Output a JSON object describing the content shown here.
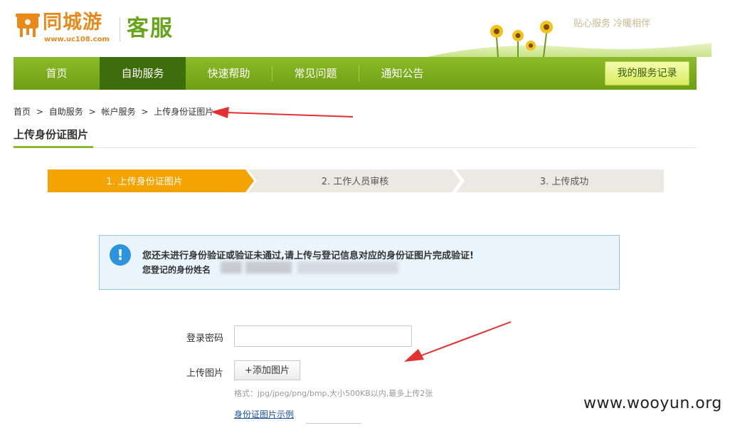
{
  "header": {
    "logo_text": "同城游",
    "logo_url": "www.uc108.com",
    "service_title": "客服",
    "slogan": "贴心服务 冷暖相伴"
  },
  "nav": {
    "items": [
      {
        "label": "首页",
        "active": false
      },
      {
        "label": "自助服务",
        "active": true
      },
      {
        "label": "快速帮助",
        "active": false
      },
      {
        "label": "常见问题",
        "active": false
      },
      {
        "label": "通知公告",
        "active": false
      }
    ],
    "records_button": "我的服务记录"
  },
  "breadcrumb": {
    "items": [
      "首页",
      "自助服务",
      "帐户服务",
      "上传身份证图片"
    ],
    "separator": ">"
  },
  "page_title": "上传身份证图片",
  "steps": [
    {
      "label": "1. 上传身份证图片",
      "active": true
    },
    {
      "label": "2. 工作人员审核",
      "active": false
    },
    {
      "label": "3. 上传成功",
      "active": false
    }
  ],
  "notice": {
    "icon": "exclamation-icon",
    "message": "您还未进行身份验证或验证未通过,请上传与登记信息对应的身份证图片完成验证!",
    "registered_label": "您登记的身份姓名"
  },
  "form": {
    "password_label": "登录密码",
    "password_value": "",
    "upload_label": "上传图片",
    "add_image_button": "+添加图片",
    "format_hint": "格式：jpg/jpeg/png/bmp,大小500KB以内,最多上传2张",
    "sample_link": "身份证图片示例"
  },
  "watermark": "www.wooyun.org",
  "colors": {
    "nav_green": "#7aab1e",
    "nav_active": "#3f6d0b",
    "step_active": "#f5a300",
    "step_inactive": "#ece9e3",
    "notice_bg": "#e9f4fc",
    "notice_border": "#92c8ea",
    "logo_orange": "#e8891c",
    "annotation_red": "#e53030"
  }
}
